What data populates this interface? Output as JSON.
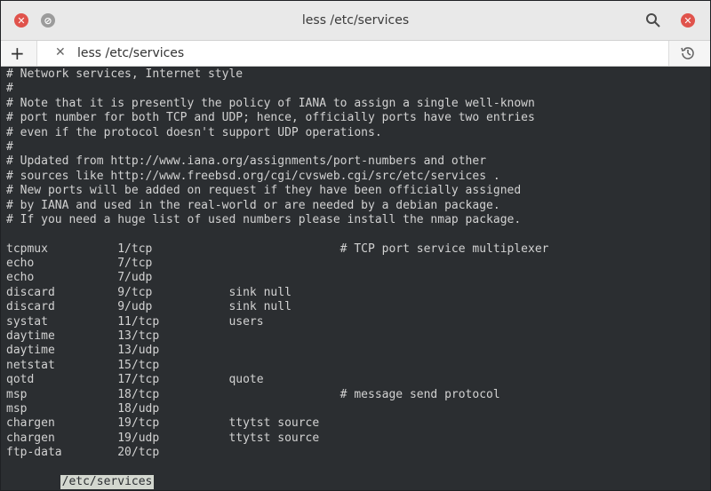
{
  "window": {
    "title": "less /etc/services"
  },
  "tabs": [
    {
      "label": "less /etc/services"
    }
  ],
  "terminal": {
    "lines": [
      "# Network services, Internet style",
      "#",
      "# Note that it is presently the policy of IANA to assign a single well-known",
      "# port number for both TCP and UDP; hence, officially ports have two entries",
      "# even if the protocol doesn't support UDP operations.",
      "#",
      "# Updated from http://www.iana.org/assignments/port-numbers and other",
      "# sources like http://www.freebsd.org/cgi/cvsweb.cgi/src/etc/services .",
      "# New ports will be added on request if they have been officially assigned",
      "# by IANA and used in the real-world or are needed by a debian package.",
      "# If you need a huge list of used numbers please install the nmap package.",
      "",
      "tcpmux          1/tcp                           # TCP port service multiplexer",
      "echo            7/tcp",
      "echo            7/udp",
      "discard         9/tcp           sink null",
      "discard         9/udp           sink null",
      "systat          11/tcp          users",
      "daytime         13/tcp",
      "daytime         13/udp",
      "netstat         15/tcp",
      "qotd            17/tcp          quote",
      "msp             18/tcp                          # message send protocol",
      "msp             18/udp",
      "chargen         19/tcp          ttytst source",
      "chargen         19/udp          ttytst source",
      "ftp-data        20/tcp"
    ],
    "status": "/etc/services"
  }
}
